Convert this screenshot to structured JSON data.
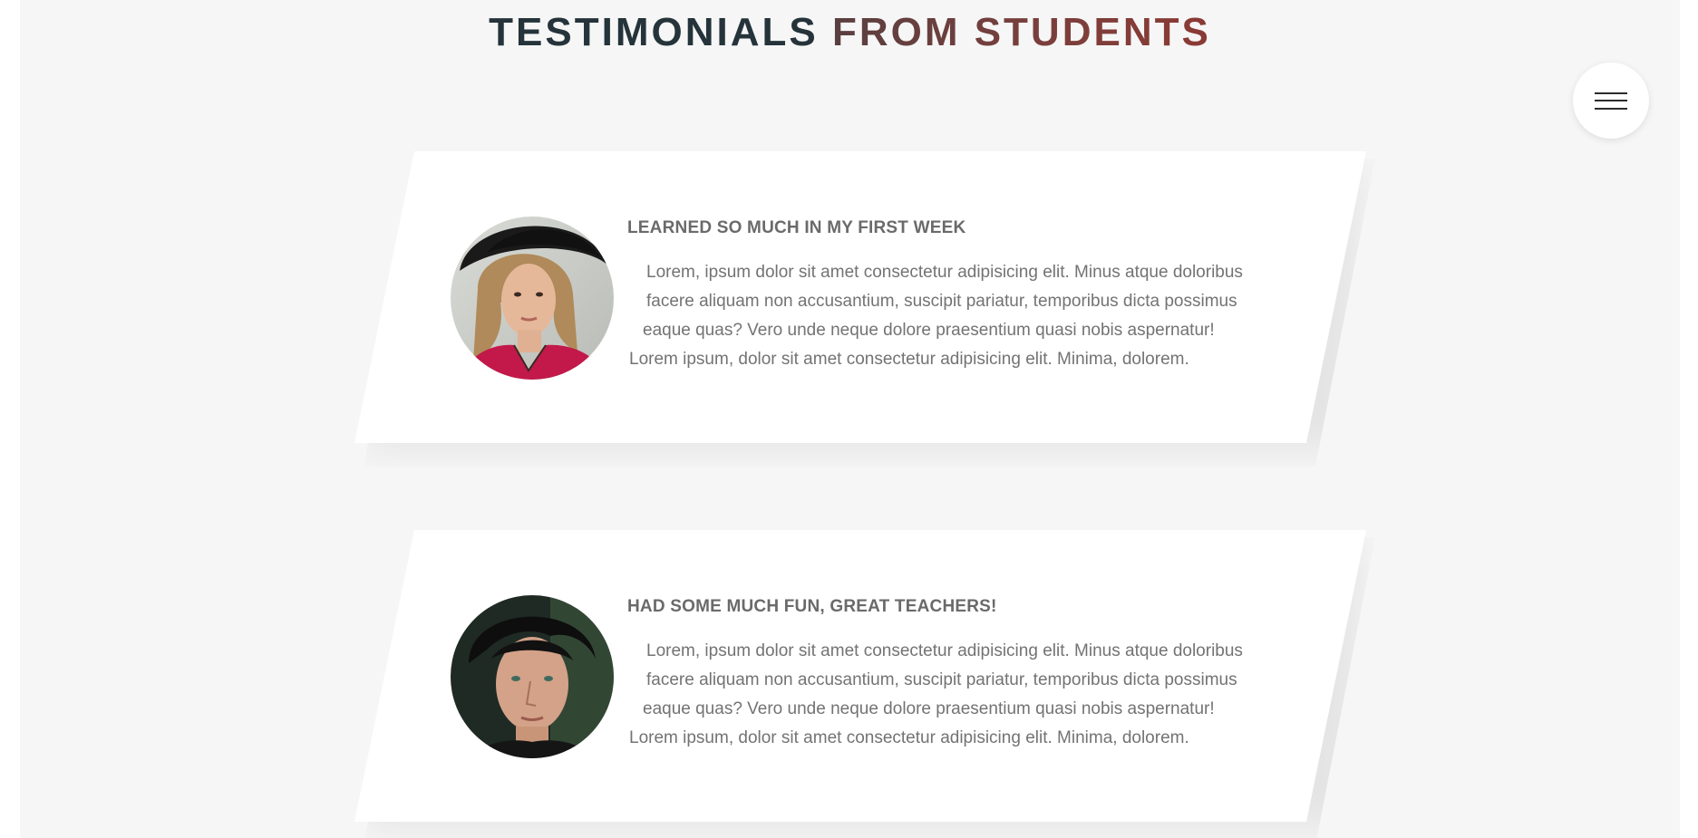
{
  "heading": {
    "part1": "TESTIMONIALS",
    "part2": "FROM STUDENTS"
  },
  "menu": {
    "icon": "hamburger-menu-icon"
  },
  "testimonials": [
    {
      "title": "LEARNED SO MUCH IN MY FIRST WEEK",
      "lines": [
        "Lorem, ipsum dolor sit amet consectetur adipisicing elit. Minus atque doloribus",
        "facere aliquam non accusantium, suscipit pariatur, temporibus dicta possimus",
        "eaque quas? Vero unde neque dolore praesentium quasi nobis aspernatur!",
        "Lorem ipsum, dolor sit amet consectetur adipisicing elit. Minima, dolorem."
      ]
    },
    {
      "title": "HAD SOME MUCH FUN, GREAT TEACHERS!",
      "lines": [
        "Lorem, ipsum dolor sit amet consectetur adipisicing elit. Minus atque doloribus",
        "facere aliquam non accusantium, suscipit pariatur, temporibus dicta possimus",
        "eaque quas? Vero unde neque dolore praesentium quasi nobis aspernatur!",
        "Lorem ipsum, dolor sit amet consectetur adipisicing elit. Minima, dolorem."
      ]
    }
  ],
  "colors": {
    "heading_dark": "#25333a",
    "heading_accent": "#7a3f3c",
    "background": "#f6f6f6",
    "card": "#ffffff",
    "text": "#737373"
  }
}
